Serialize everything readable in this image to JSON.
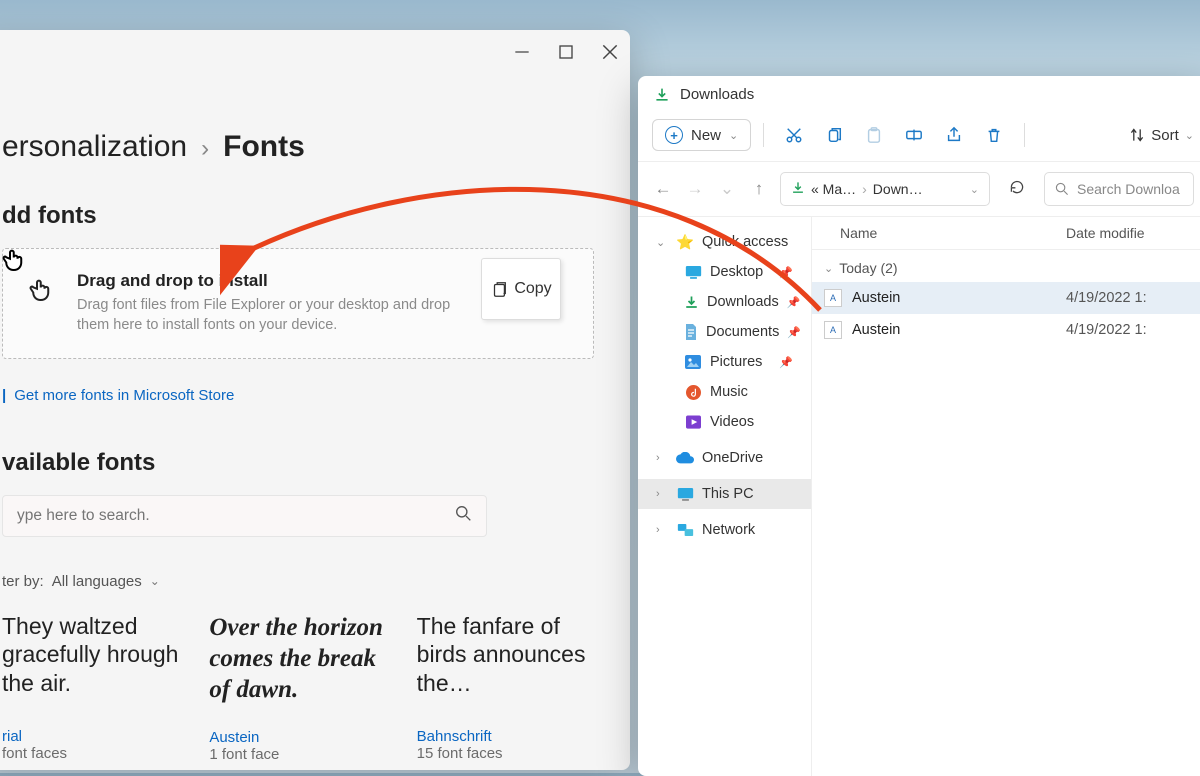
{
  "settings": {
    "breadcrumb": {
      "parent": "ersonalization",
      "current": "Fonts"
    },
    "addFontsHeading": "dd fonts",
    "drop": {
      "title": "Drag and drop to install",
      "desc": "Drag font files from File Explorer or your desktop and drop them here to install fonts on your device."
    },
    "dragGhost": "Copy",
    "storeLink": "Get more fonts in Microsoft Store",
    "availableHeading": "vailable fonts",
    "searchPlaceholder": "ype here to search.",
    "filter": {
      "label": "ter by:",
      "value": "All languages"
    },
    "cards": [
      {
        "sample": "They waltzed gracefully hrough the air.",
        "name": "rial",
        "faces": "font faces"
      },
      {
        "sample": "Over the horizon comes the break of dawn.",
        "name": "Austein",
        "faces": "1 font face"
      },
      {
        "sample": "The fanfare of birds announces the…",
        "name": "Bahnschrift",
        "faces": "15 font faces"
      }
    ]
  },
  "explorer": {
    "title": "Downloads",
    "toolbar": {
      "new": "New",
      "sort": "Sort"
    },
    "path": {
      "seg1": "« Ma…",
      "seg2": "Down…",
      "searchPlaceholder": "Search Downloa"
    },
    "tree": {
      "quickAccess": "Quick access",
      "subs": [
        {
          "label": "Desktop",
          "pin": true
        },
        {
          "label": "Downloads",
          "pin": true
        },
        {
          "label": "Documents",
          "pin": true
        },
        {
          "label": "Pictures",
          "pin": true
        },
        {
          "label": "Music",
          "pin": false
        },
        {
          "label": "Videos",
          "pin": false
        }
      ],
      "oneDrive": "OneDrive",
      "thisPC": "This PC",
      "network": "Network"
    },
    "columns": {
      "name": "Name",
      "date": "Date modifie"
    },
    "group": "Today (2)",
    "files": [
      {
        "name": "Austein",
        "date": "4/19/2022 1:"
      },
      {
        "name": "Austein",
        "date": "4/19/2022 1:"
      }
    ]
  }
}
